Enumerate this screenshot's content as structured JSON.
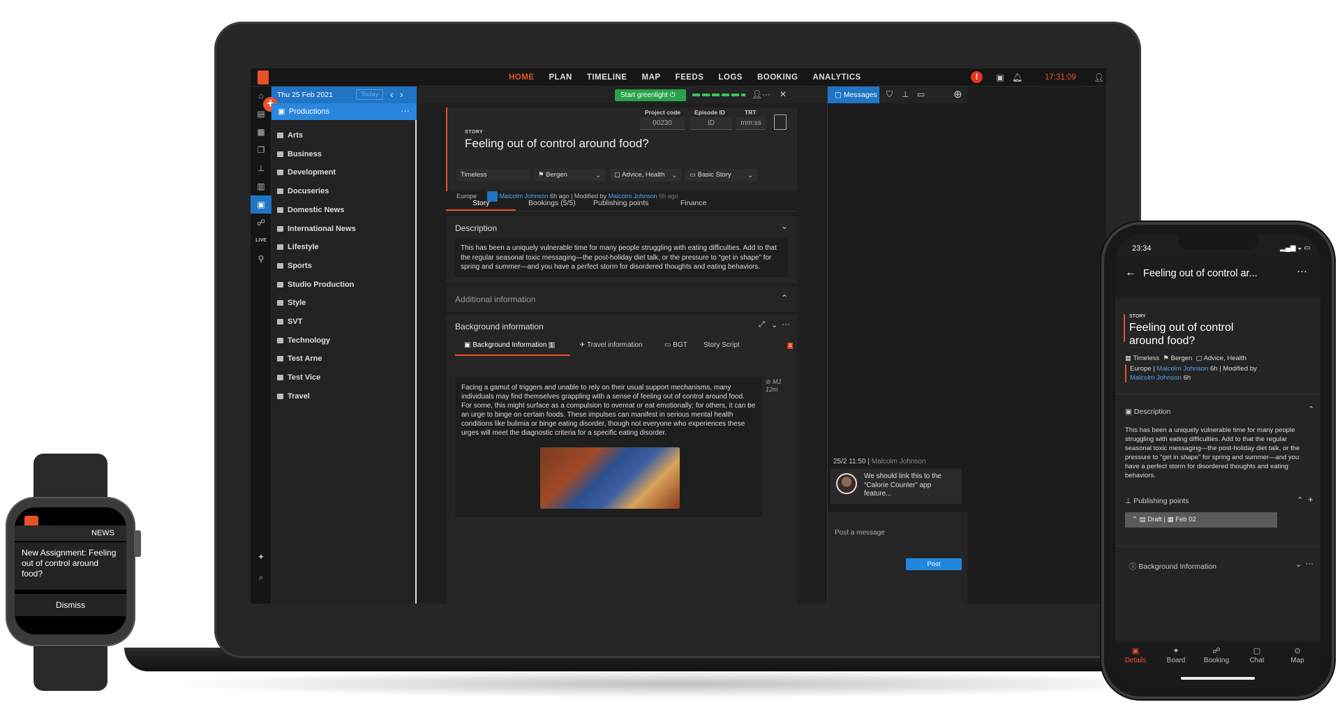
{
  "nav": {
    "menu": [
      "HOME",
      "PLAN",
      "TIMELINE",
      "MAP",
      "FEEDS",
      "LOGS",
      "BOOKING",
      "ANALYTICS"
    ],
    "active": "HOME",
    "clock": "17:31:09",
    "alert": "!"
  },
  "folders": {
    "date": "Thu 25 Feb 2021",
    "today": "Today",
    "selected": "Productions",
    "items": [
      "Arts",
      "Business",
      "Development",
      "Docuseries",
      "Domestic News",
      "International News",
      "Lifestyle",
      "Sports",
      "Studio Production",
      "Style",
      "SVT",
      "Technology",
      "Test Arne",
      "Test Vice",
      "Travel"
    ]
  },
  "rail": {
    "live": "LIVE"
  },
  "toolbar": {
    "greenlight": "Start greenlight"
  },
  "story": {
    "label": "STORY",
    "title": "Feeling out of control around food?",
    "project_code_label": "Project code",
    "project_code": "00230",
    "episode_label": "Episode ID",
    "episode": "ID",
    "trt_label": "TRT",
    "trt": "mm:ss",
    "dd_timeless": "Timeless",
    "dd_bergen": "Bergen",
    "dd_topic": "Advice, Health",
    "dd_type": "Basic Story",
    "region": "Europe",
    "author": "Malcolm Johnson",
    "ago1": "6h ago",
    "modified_by": "Modified by",
    "ago2": "6h ago",
    "sep": "|"
  },
  "tabs": [
    "Story",
    "Bookings (5/5)",
    "Publishing points",
    "Finance"
  ],
  "desc": {
    "title": "Description",
    "text": "This has been a uniquely vulnerable time for many people struggling with eating difficulties. Add to that the regular seasonal toxic messaging—the post-holiday diet talk, or the pressure to “get in shape” for spring and summer—and you have a perfect storm for disordered thoughts and eating behaviors."
  },
  "additional": {
    "title": "Additional information"
  },
  "background": {
    "title": "Background information",
    "tabs": [
      "Background Information",
      "Travel information",
      "BGT",
      "Story Script"
    ],
    "badge": "1",
    "alert": "4",
    "text": "Facing a gamut of triggers and unable to rely on their usual support mechanisms, many individuals may find themselves grappling with a sense of feeling out of control around food. For some, this might surface as a compulsion to overeat or eat emotionally; for others, it can be an urge to binge on certain foods. These impulses can manifest in serious mental health conditions like bulimia or binge eating disorder, though not everyone who experiences these urges will meet the diagnostic criteria for a specific eating disorder.",
    "editor": "MJ",
    "editor_time": "12m"
  },
  "messages": {
    "tab": "Messages",
    "time": "25/2 11:50",
    "sep": "|",
    "author": "Malcolm Johnson",
    "text": "We should link this to the “Calorie Counter” app feature...",
    "placeholder": "Post a message",
    "post": "Post"
  },
  "phone": {
    "time": "23:34",
    "header": "Feeling out of control ar...",
    "label": "STORY",
    "title": "Feeling out of control around food?",
    "timeless": "Timeless",
    "bergen": "Bergen",
    "topic": "Advice, Health",
    "region": "Europe",
    "sep": "|",
    "author": "Malcolm Johnson",
    "ago": "6h",
    "modified": "Modified by",
    "author2": "Malcolm Johnson",
    "ago2": "6h",
    "desc_title": "Description",
    "desc": "This has been a uniquely vulnerable time for many people struggling with eating difficulties. Add to that the regular seasonal toxic messaging—the post-holiday diet talk, or the pressure to “get in shape” for spring and summer—and you have a perfect storm for disordered thoughts and eating behaviors.",
    "pub_title": "Publishing points",
    "draft": "Draft",
    "draft_sep": "|",
    "draft_date": "Feb 02",
    "bg_title": "Background Information",
    "nav": [
      "Details",
      "Board",
      "Booking",
      "Chat",
      "Map"
    ]
  },
  "watch": {
    "tag": "NEWS",
    "text": "New Assignment: Feeling out of control around food?",
    "dismiss": "Dismiss"
  },
  "colors": {
    "accent": "#e8512a",
    "primary": "#1f74c4",
    "green": "#2aa24a"
  }
}
